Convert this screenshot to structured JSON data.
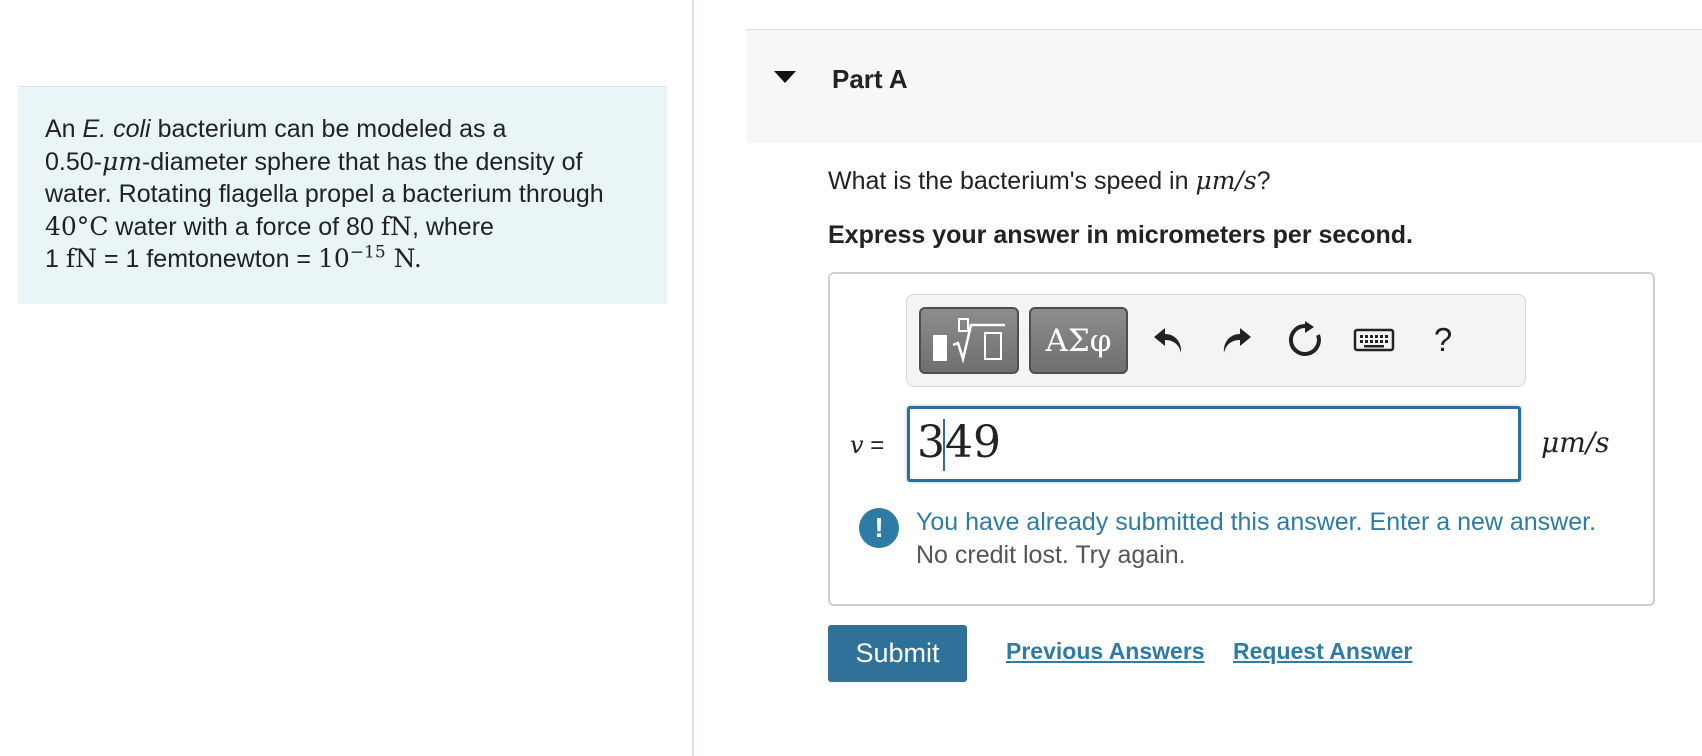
{
  "problem": {
    "intro": "An ",
    "species": "E. coli",
    "line1_rest": " bacterium can be modeled as a",
    "diameter_value": "0.50-",
    "diameter_unit": "μm",
    "line2_rest": "-diameter sphere that has the density of",
    "line3": "water. Rotating flagella propel a bacterium through",
    "temp_value": "40°",
    "temp_unit": "C",
    "line4_mid": " water with a force of 80 ",
    "force_unit": "fN",
    "line4_end": ", where",
    "def_lhs_num": "1 ",
    "def_lhs_unit": "fN",
    "def_mid": " = 1 femtonewton = ",
    "def_base": "10",
    "def_exp": "−15",
    "def_unit": " N."
  },
  "part": {
    "title": "Part A"
  },
  "question": {
    "prefix": "What is the bacterium's speed in ",
    "unit": "μm/s",
    "suffix": "?"
  },
  "instruction": "Express your answer in micrometers per second.",
  "toolbar": {
    "greek_label": "ΑΣφ",
    "help_label": "?"
  },
  "answer": {
    "variable": "v",
    "equals": " =",
    "value": "349",
    "unit": "μm/s"
  },
  "feedback": {
    "icon": "!",
    "message": "You have already submitted this answer. Enter a new answer.",
    "detail": "No credit lost. Try again."
  },
  "actions": {
    "submit_label": "Submit",
    "previous_answers_label": "Previous Answers",
    "request_answer_label": "Request Answer"
  },
  "colors": {
    "accent": "#2f7199",
    "problem_bg": "#e9f5f6",
    "input_border": "#2f6f97"
  }
}
